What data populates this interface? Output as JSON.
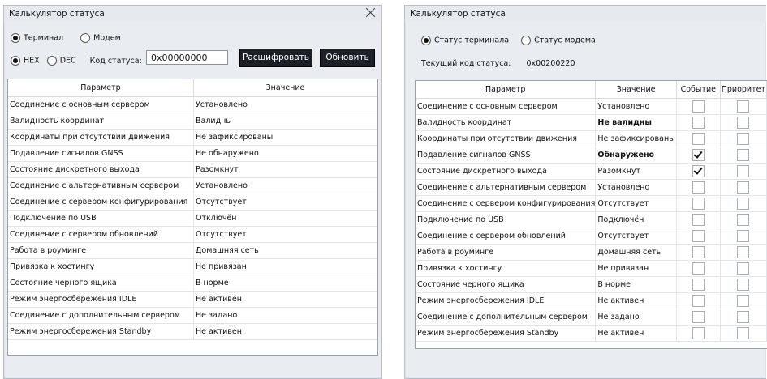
{
  "left": {
    "title": "Калькулятор статуса",
    "radio_terminal": "Терминал",
    "radio_modem": "Модем",
    "radio_hex": "HEX",
    "radio_dec": "DEC",
    "code_label": "Код статуса:",
    "code_value": "0x00000000",
    "decode_button": "Расшифровать",
    "refresh_button": "Обновить",
    "columns": [
      "Параметр",
      "Значение"
    ],
    "rows": [
      [
        "Соединение с основным сервером",
        "Установлено"
      ],
      [
        "Валидность координат",
        "Валидны"
      ],
      [
        "Координаты при отсутствии движения",
        "Не зафиксированы"
      ],
      [
        "Подавление сигналов GNSS",
        "Не обнаружено"
      ],
      [
        "Состояние дискретного выхода",
        "Разомкнут"
      ],
      [
        "Соединение с альтернативным сервером",
        "Установлено"
      ],
      [
        "Соединение с сервером конфигурирования",
        "Отсутствует"
      ],
      [
        "Подключение по USB",
        "Отключён"
      ],
      [
        "Соединение с сервером обновлений",
        "Отсутствует"
      ],
      [
        "Работа в роуминге",
        "Домашняя сеть"
      ],
      [
        "Привязка к хостингу",
        "Не привязан"
      ],
      [
        "Состояние черного ящика",
        "В норме"
      ],
      [
        "Режим энергосбережения IDLE",
        "Не активен"
      ],
      [
        "Соединение с дополнительным сервером",
        "Не задано"
      ],
      [
        "Режим энергосбережения Standby",
        "Не активен"
      ]
    ]
  },
  "right": {
    "title": "Калькулятор статуса",
    "radio_terminal": "Статус терминала",
    "radio_modem": "Статус модема",
    "current_label": "Текущий код статуса:",
    "current_value": "0x00200220",
    "columns": [
      "Параметр",
      "Значение",
      "Событие",
      "Приоритет"
    ],
    "rows": [
      {
        "param": "Соединение с основным сервером",
        "value": "Установлено",
        "bold": false,
        "event": false,
        "priority": false
      },
      {
        "param": "Валидность координат",
        "value": "Не валидны",
        "bold": true,
        "event": false,
        "priority": false
      },
      {
        "param": "Координаты при отсутствии движения",
        "value": "Не зафиксированы",
        "bold": false,
        "event": false,
        "priority": false
      },
      {
        "param": "Подавление сигналов GNSS",
        "value": "Обнаружено",
        "bold": true,
        "event": true,
        "priority": false
      },
      {
        "param": "Состояние дискретного выхода",
        "value": "Разомкнут",
        "bold": false,
        "event": true,
        "priority": false
      },
      {
        "param": "Соединение с альтернативным сервером",
        "value": "Установлено",
        "bold": false,
        "event": false,
        "priority": false
      },
      {
        "param": "Соединение с сервером конфигурирования",
        "value": "Отсутствует",
        "bold": false,
        "event": false,
        "priority": false
      },
      {
        "param": "Подключение по USB",
        "value": "Подключён",
        "bold": false,
        "event": false,
        "priority": false
      },
      {
        "param": "Соединение с сервером обновлений",
        "value": "Отсутствует",
        "bold": false,
        "event": false,
        "priority": false
      },
      {
        "param": "Работа в роуминге",
        "value": "Домашняя сеть",
        "bold": false,
        "event": false,
        "priority": false
      },
      {
        "param": "Привязка к хостингу",
        "value": "Не привязан",
        "bold": false,
        "event": false,
        "priority": false
      },
      {
        "param": "Состояние черного ящика",
        "value": "В норме",
        "bold": false,
        "event": false,
        "priority": false
      },
      {
        "param": "Режим энергосбережения IDLE",
        "value": "Не активен",
        "bold": false,
        "event": false,
        "priority": false
      },
      {
        "param": "Соединение с дополнительным сервером",
        "value": "Не задано",
        "bold": false,
        "event": false,
        "priority": false
      },
      {
        "param": "Режим энергосбережения Standby",
        "value": "Не активен",
        "bold": false,
        "event": false,
        "priority": false
      }
    ]
  }
}
